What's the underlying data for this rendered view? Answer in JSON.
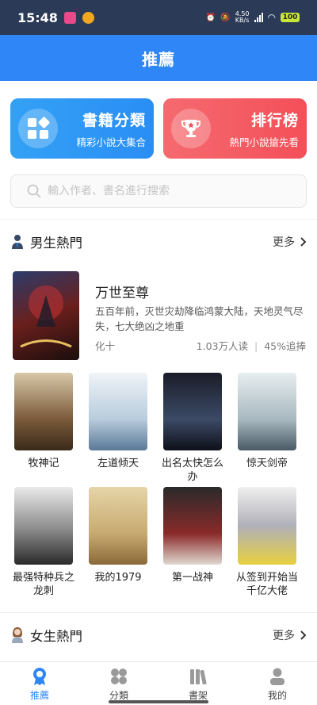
{
  "status": {
    "time": "15:48",
    "speed": "4.50\nKB/s",
    "battery": "100"
  },
  "header": {
    "title": "推薦"
  },
  "categories": [
    {
      "title": "書籍分類",
      "subtitle": "精彩小說大集合",
      "icon": "grid-icon"
    },
    {
      "title": "排行榜",
      "subtitle": "熱門小說搶先看",
      "icon": "trophy-icon"
    }
  ],
  "search": {
    "placeholder": "輸入作者、書名進行搜索",
    "value": ""
  },
  "male_section": {
    "title": "男生熱門",
    "more": "更多",
    "featured": {
      "title": "万世至尊",
      "description": "五百年前，灭世灾劫降临鸿蒙大陆，天地灵气尽失，七大绝凶之地重",
      "author": "化十",
      "readers": "1.03万人读",
      "retention": "45%追捧"
    },
    "books": [
      {
        "title": "牧神记"
      },
      {
        "title": "左道倾天"
      },
      {
        "title": "出名太快怎么办"
      },
      {
        "title": "惊天剑帝"
      },
      {
        "title": "最强特种兵之龙刺"
      },
      {
        "title": "我的1979"
      },
      {
        "title": "第一战神"
      },
      {
        "title": "从签到开始当千亿大佬"
      }
    ]
  },
  "female_section": {
    "title": "女生熱門",
    "more": "更多"
  },
  "bottom_nav": [
    {
      "label": "推薦",
      "icon": "recommend-badge-icon",
      "active": true
    },
    {
      "label": "分類",
      "icon": "category-grid-icon",
      "active": false
    },
    {
      "label": "書架",
      "icon": "bookshelf-icon",
      "active": false
    },
    {
      "label": "我的",
      "icon": "profile-icon",
      "active": false
    }
  ],
  "colors": {
    "primary": "#2f86f6",
    "blue_card": "#2a8ef5",
    "red_card": "#f44f59",
    "statusbar": "#2b3a57"
  }
}
